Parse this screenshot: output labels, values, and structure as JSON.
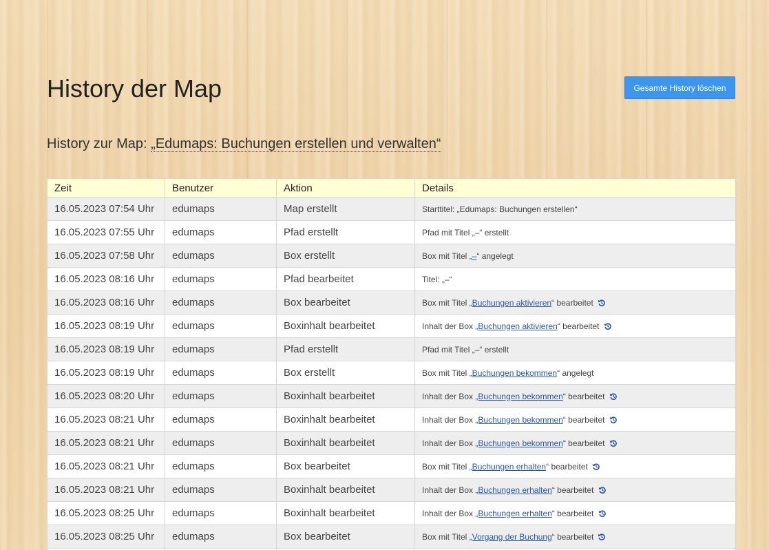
{
  "page": {
    "title": "History der Map",
    "clear_button_label": "Gesamte History löschen",
    "subtitle_prefix": "History zur Map: ",
    "map_link_text": "„Edumaps: Buchungen erstellen und verwalten“"
  },
  "colors": {
    "accent": "#3d95ec",
    "header_bg": "#ffffd6",
    "link": "#2a56a8"
  },
  "table": {
    "columns": [
      "Zeit",
      "Benutzer",
      "Aktion",
      "Details"
    ],
    "rows": [
      {
        "zeit": "16.05.2023 07:54 Uhr",
        "benutzer": "edumaps",
        "aktion": "Map erstellt",
        "details": {
          "prefix": "Starttitel: „Edumaps: Buchungen erstellen“",
          "link": "",
          "suffix": "",
          "undo": false
        }
      },
      {
        "zeit": "16.05.2023 07:55 Uhr",
        "benutzer": "edumaps",
        "aktion": "Pfad erstellt",
        "details": {
          "prefix": "Pfad mit Titel „–“ erstellt",
          "link": "",
          "suffix": "",
          "undo": false
        }
      },
      {
        "zeit": "16.05.2023 07:58 Uhr",
        "benutzer": "edumaps",
        "aktion": "Box erstellt",
        "details": {
          "prefix": "Box mit Titel ",
          "link": "„–",
          "suffix": "“ angelegt",
          "undo": false
        }
      },
      {
        "zeit": "16.05.2023 08:16 Uhr",
        "benutzer": "edumaps",
        "aktion": "Pfad bearbeitet",
        "details": {
          "prefix": "Titel: „–“",
          "link": "",
          "suffix": "",
          "undo": false
        }
      },
      {
        "zeit": "16.05.2023 08:16 Uhr",
        "benutzer": "edumaps",
        "aktion": "Box bearbeitet",
        "details": {
          "prefix": "Box mit Titel ",
          "link": "„Buchungen aktivieren",
          "suffix": "“ bearbeitet",
          "undo": true
        }
      },
      {
        "zeit": "16.05.2023 08:19 Uhr",
        "benutzer": "edumaps",
        "aktion": "Boxinhalt bearbeitet",
        "details": {
          "prefix": "Inhalt der Box ",
          "link": "„Buchungen aktivieren",
          "suffix": "“ bearbeitet",
          "undo": true
        }
      },
      {
        "zeit": "16.05.2023 08:19 Uhr",
        "benutzer": "edumaps",
        "aktion": "Pfad erstellt",
        "details": {
          "prefix": "Pfad mit Titel „–“ erstellt",
          "link": "",
          "suffix": "",
          "undo": false
        }
      },
      {
        "zeit": "16.05.2023 08:19 Uhr",
        "benutzer": "edumaps",
        "aktion": "Box erstellt",
        "details": {
          "prefix": "Box mit Titel ",
          "link": "„Buchungen bekommen",
          "suffix": "“ angelegt",
          "undo": false
        }
      },
      {
        "zeit": "16.05.2023 08:20 Uhr",
        "benutzer": "edumaps",
        "aktion": "Boxinhalt bearbeitet",
        "details": {
          "prefix": "Inhalt der Box ",
          "link": "„Buchungen bekommen",
          "suffix": "“ bearbeitet",
          "undo": true
        }
      },
      {
        "zeit": "16.05.2023 08:21 Uhr",
        "benutzer": "edumaps",
        "aktion": "Boxinhalt bearbeitet",
        "details": {
          "prefix": "Inhalt der Box ",
          "link": "„Buchungen bekommen",
          "suffix": "“ bearbeitet",
          "undo": true
        }
      },
      {
        "zeit": "16.05.2023 08:21 Uhr",
        "benutzer": "edumaps",
        "aktion": "Boxinhalt bearbeitet",
        "details": {
          "prefix": "Inhalt der Box ",
          "link": "„Buchungen bekommen",
          "suffix": "“ bearbeitet",
          "undo": true
        }
      },
      {
        "zeit": "16.05.2023 08:21 Uhr",
        "benutzer": "edumaps",
        "aktion": "Box bearbeitet",
        "details": {
          "prefix": "Box mit Titel ",
          "link": "„Buchungen erhalten",
          "suffix": "“ bearbeitet",
          "undo": true
        }
      },
      {
        "zeit": "16.05.2023 08:21 Uhr",
        "benutzer": "edumaps",
        "aktion": "Boxinhalt bearbeitet",
        "details": {
          "prefix": "Inhalt der Box ",
          "link": "„Buchungen erhalten",
          "suffix": "“ bearbeitet",
          "undo": true
        }
      },
      {
        "zeit": "16.05.2023 08:25 Uhr",
        "benutzer": "edumaps",
        "aktion": "Boxinhalt bearbeitet",
        "details": {
          "prefix": "Inhalt der Box ",
          "link": "„Buchungen erhalten",
          "suffix": "“ bearbeitet",
          "undo": true
        }
      },
      {
        "zeit": "16.05.2023 08:25 Uhr",
        "benutzer": "edumaps",
        "aktion": "Box bearbeitet",
        "details": {
          "prefix": "Box mit Titel ",
          "link": "„Vorgang der Buchung",
          "suffix": "“ bearbeitet",
          "undo": true
        }
      },
      {
        "zeit": "",
        "benutzer": "",
        "aktion": "",
        "details": {
          "prefix": "",
          "link": "",
          "suffix": "",
          "undo": false
        }
      }
    ]
  },
  "icons": {
    "undo": "undo-icon"
  }
}
